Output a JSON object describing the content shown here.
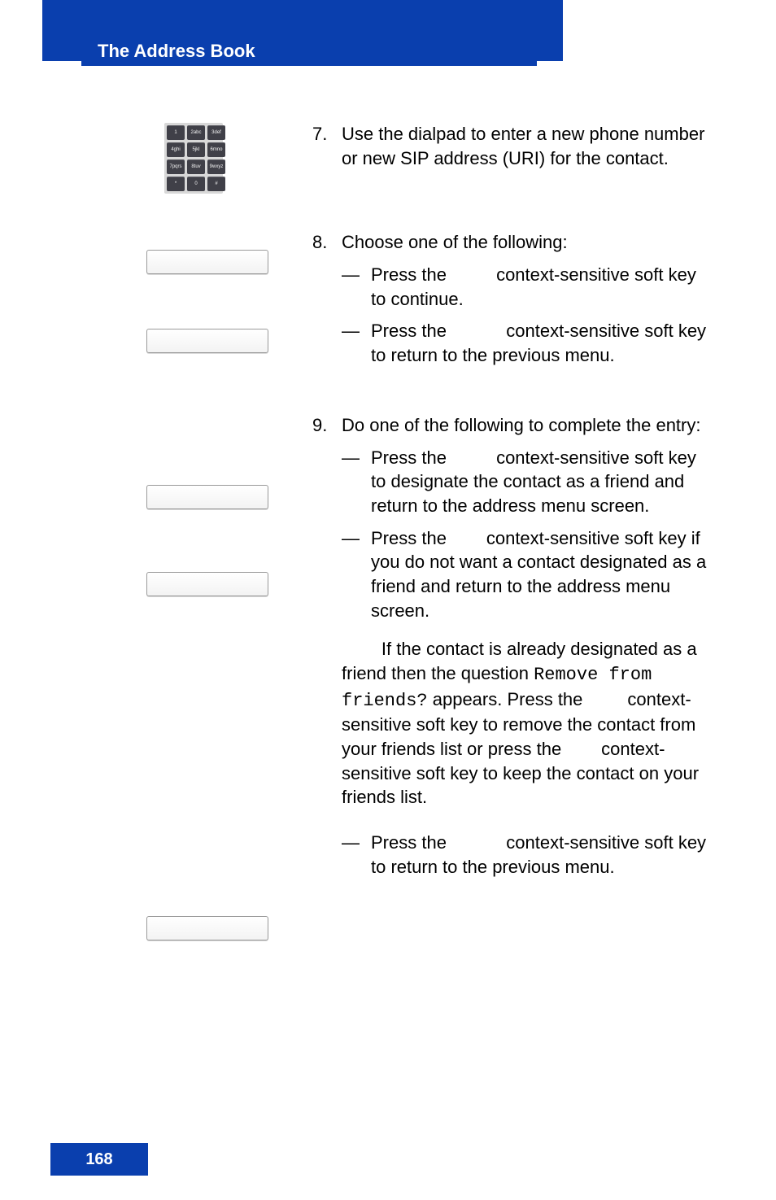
{
  "header": {
    "title": "The Address Book"
  },
  "page_number": "168",
  "dialpad": [
    "1",
    "2abc",
    "3def",
    "4ghi",
    "5jkl",
    "6mno",
    "7pqrs",
    "8tuv",
    "9wxyz",
    "*",
    "0",
    "#"
  ],
  "steps": {
    "s7": {
      "num": "7.",
      "text": "Use the dialpad to enter a new phone number or new SIP address (URI) for the contact."
    },
    "s8": {
      "num": "8.",
      "intro": "Choose one of the following:",
      "a_pre": "Press the ",
      "a_post": " context-sensitive soft key to continue.",
      "b_pre": "Press the ",
      "b_post": " context-sensitive soft key to return to the previous menu."
    },
    "s9": {
      "num": "9.",
      "intro": "Do one of the following to complete the entry:",
      "a_pre": "Press the ",
      "a_post": " context-sensitive soft key to designate the contact as a friend and return to the address menu screen.",
      "b_pre": "Press the ",
      "b_post": " context-sensitive soft key if you do not want a contact designated as a friend and return to the address menu screen.",
      "note_pre": "If the contact is already designated as a friend then the question ",
      "note_code": "Remove from friends?",
      "note_mid1": " appears. Press the ",
      "note_mid2": " context-sensitive soft key to remove the contact from your friends list or press the ",
      "note_post": " context-sensitive soft key to keep the contact on your friends list.",
      "c_pre": "Press the ",
      "c_post": " context-sensitive soft key to return to the previous menu."
    }
  },
  "dash": "—"
}
